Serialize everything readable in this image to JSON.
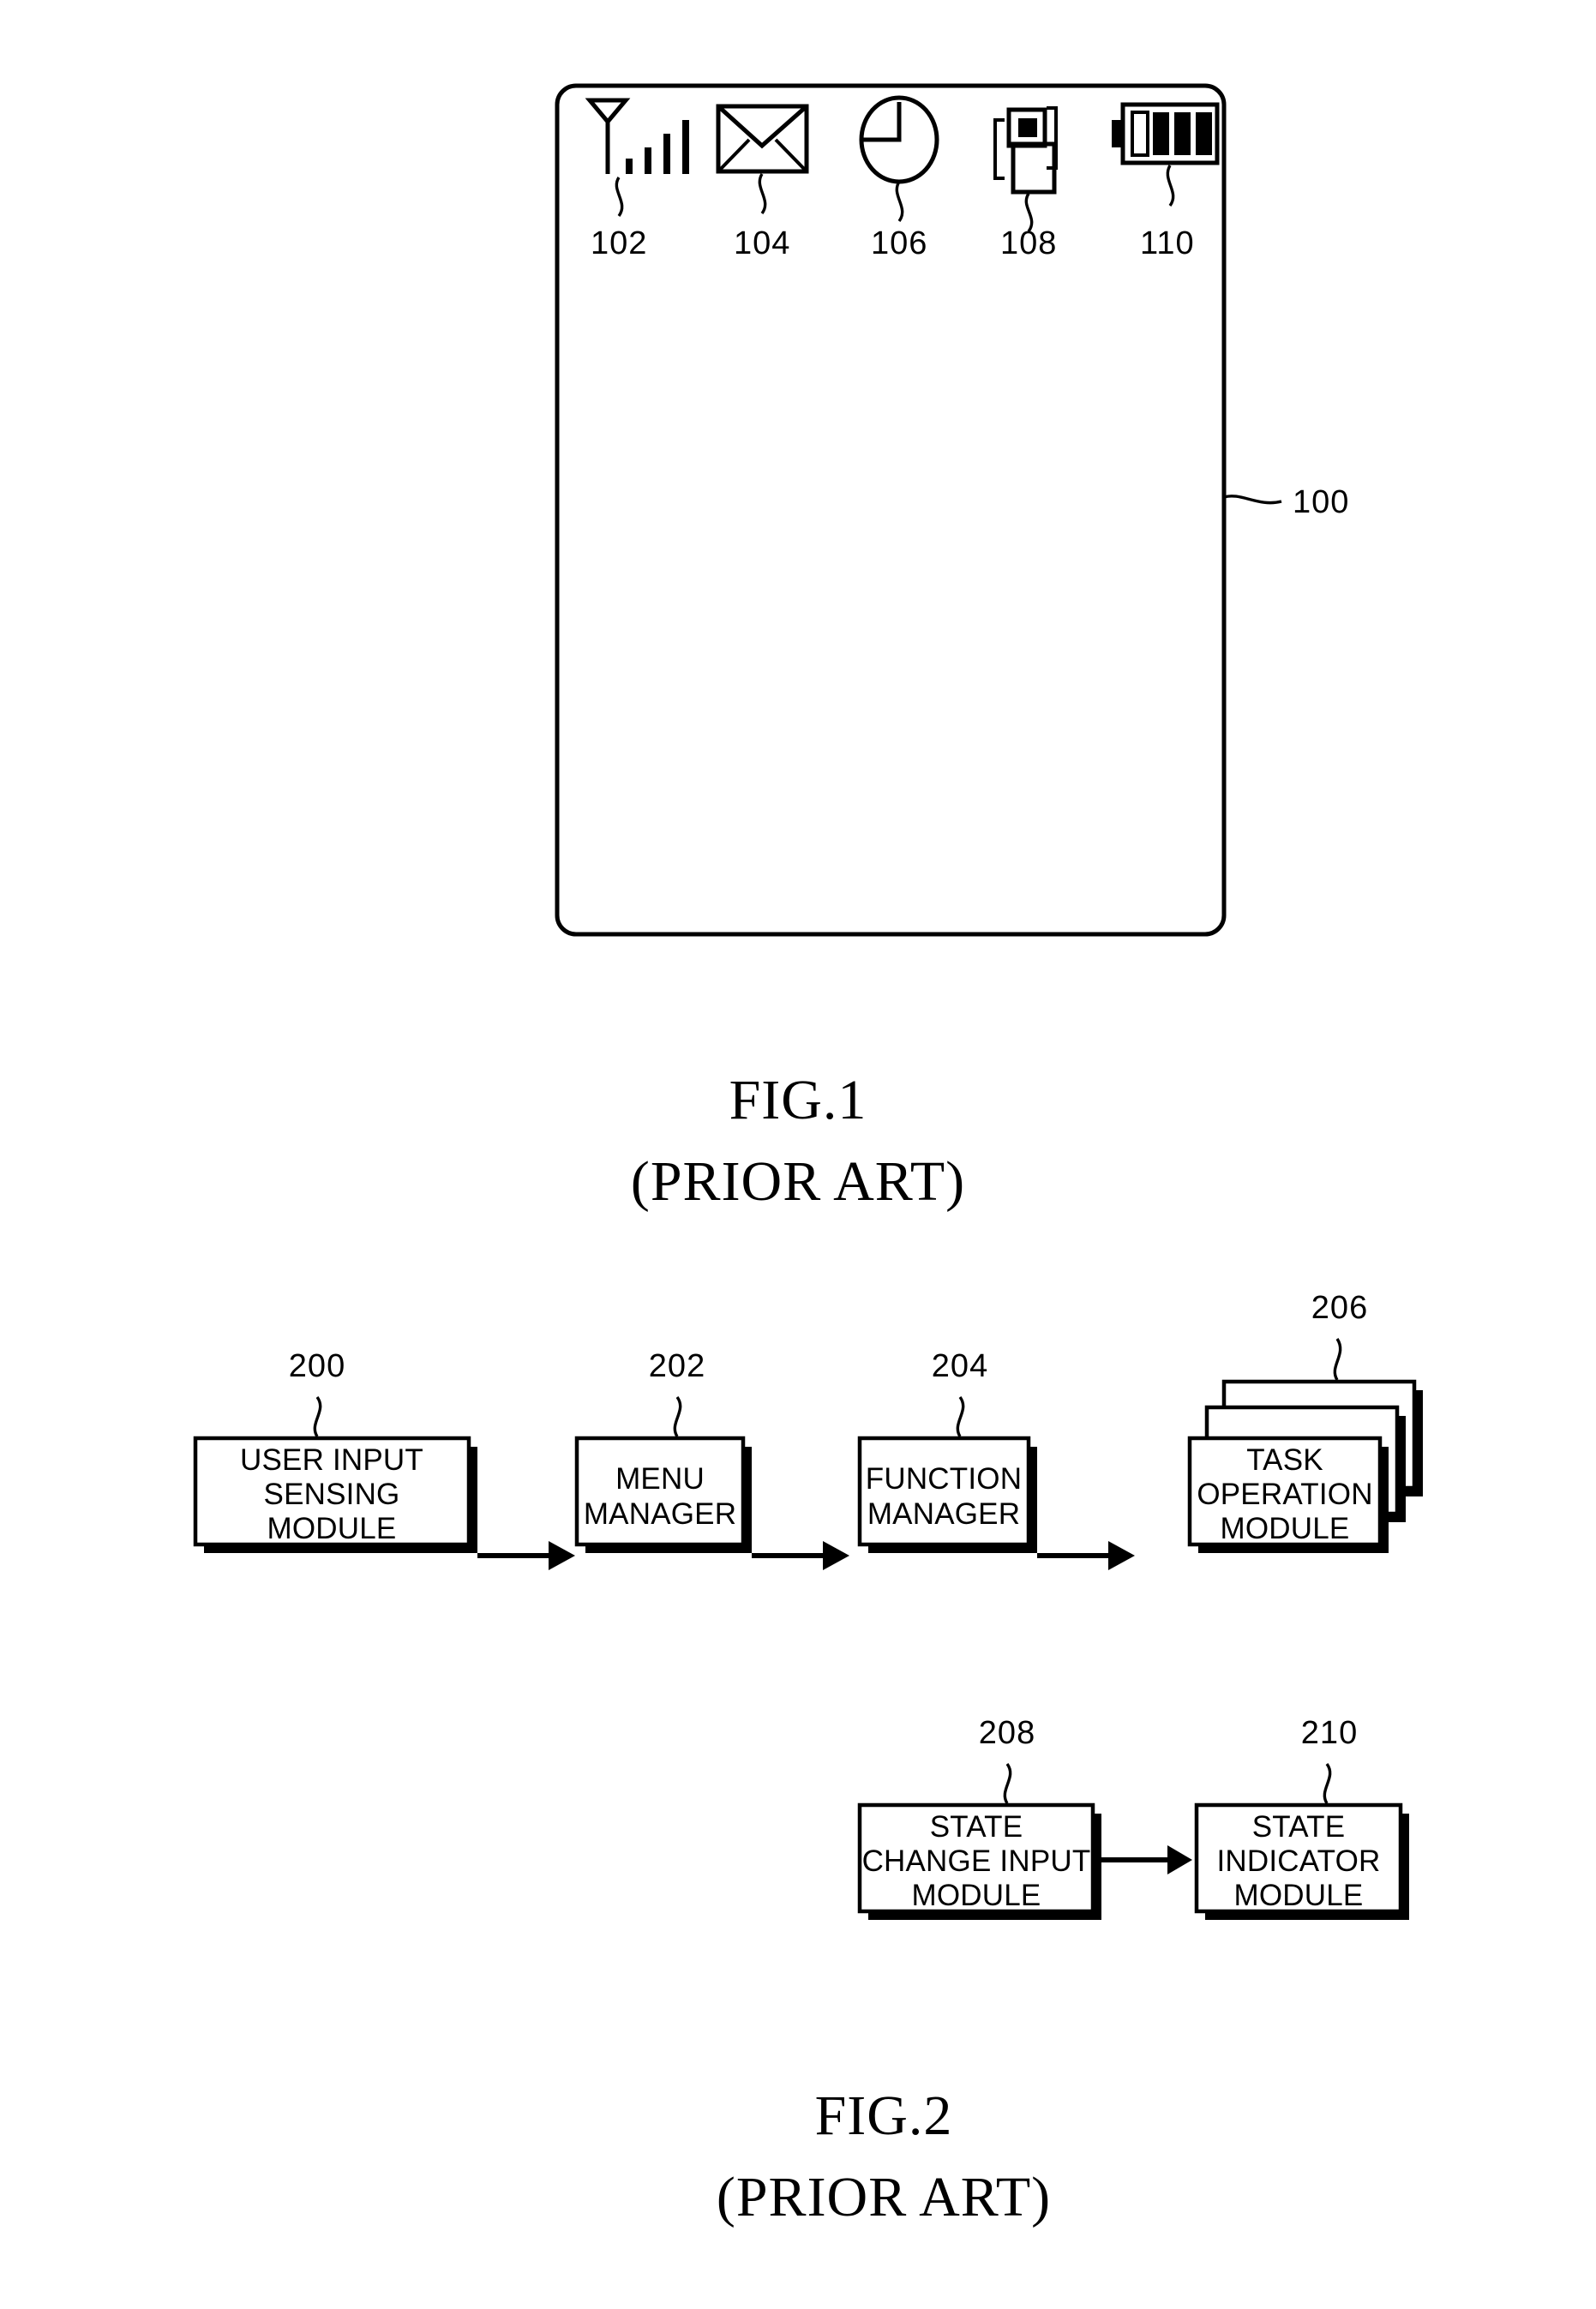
{
  "document": {
    "type": "patent-drawing-sheet",
    "background_color": "#ffffff",
    "ink_color": "#000000"
  },
  "figure1": {
    "caption": "FIG.1",
    "subcaption": "(PRIOR ART)",
    "device_ref": "100",
    "status_bar": {
      "icons": [
        {
          "name": "signal-strength-icon",
          "ref": "102",
          "bars": 4,
          "filled_bars": 4
        },
        {
          "name": "message-envelope-icon",
          "ref": "104"
        },
        {
          "name": "alarm-clock-icon",
          "ref": "106"
        },
        {
          "name": "vibration-mode-icon",
          "ref": "108"
        },
        {
          "name": "battery-icon",
          "ref": "110",
          "cells": 4,
          "filled_cells": 3
        }
      ]
    }
  },
  "figure2": {
    "caption": "FIG.2",
    "subcaption": "(PRIOR ART)",
    "blocks": [
      {
        "ref": "200",
        "lines": [
          "USER INPUT",
          "SENSING",
          "MODULE"
        ],
        "stacked": false
      },
      {
        "ref": "202",
        "lines": [
          "MENU",
          "MANAGER"
        ],
        "stacked": false
      },
      {
        "ref": "204",
        "lines": [
          "FUNCTION",
          "MANAGER"
        ],
        "stacked": false
      },
      {
        "ref": "206",
        "lines": [
          "TASK",
          "OPERATION",
          "MODULE"
        ],
        "stacked": true
      },
      {
        "ref": "208",
        "lines": [
          "STATE",
          "CHANGE INPUT",
          "MODULE"
        ],
        "stacked": false
      },
      {
        "ref": "210",
        "lines": [
          "STATE",
          "INDICATOR",
          "MODULE"
        ],
        "stacked": false
      }
    ],
    "connections": [
      {
        "from": "200",
        "to": "202"
      },
      {
        "from": "202",
        "to": "204"
      },
      {
        "from": "204",
        "to": "206"
      },
      {
        "from": "208",
        "to": "210"
      }
    ]
  }
}
